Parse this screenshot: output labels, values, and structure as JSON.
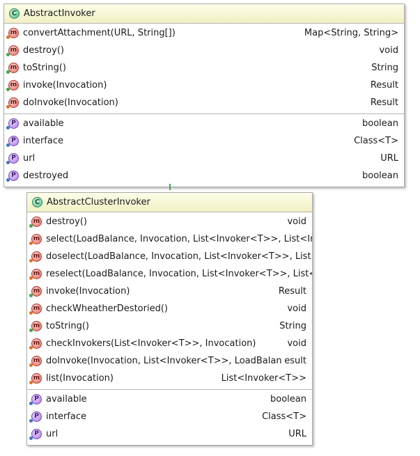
{
  "abstract_invoker": {
    "title": "AbstractInvoker",
    "kind_icon": "class-icon",
    "methods": [
      {
        "name": "convertAttachment(URL, String[])",
        "type": "Map<String, String>",
        "visibility": "protected",
        "icon": "method-icon"
      },
      {
        "name": "destroy()",
        "type": "void",
        "visibility": "public",
        "icon": "method-icon"
      },
      {
        "name": "toString()",
        "type": "String",
        "visibility": "public",
        "icon": "method-icon"
      },
      {
        "name": "invoke(Invocation)",
        "type": "Result",
        "visibility": "public",
        "icon": "method-icon"
      },
      {
        "name": "doInvoke(Invocation)",
        "type": "Result",
        "visibility": "protected-abstract",
        "icon": "method-icon"
      }
    ],
    "properties": [
      {
        "name": "available",
        "type": "boolean",
        "icon": "property-icon"
      },
      {
        "name": "interface",
        "type": "Class<T>",
        "icon": "property-icon"
      },
      {
        "name": "url",
        "type": "URL",
        "icon": "property-icon"
      },
      {
        "name": "destroyed",
        "type": "boolean",
        "icon": "property-icon"
      }
    ]
  },
  "abstract_cluster_invoker": {
    "title": "AbstractClusterInvoker",
    "kind_icon": "class-icon",
    "methods": [
      {
        "name": "destroy()",
        "type": "void",
        "visibility": "public",
        "icon": "method-icon"
      },
      {
        "name": "select(LoadBalance, Invocation, List<Invoker<T>>, List<Invoke",
        "type": "",
        "visibility": "protected",
        "icon": "method-icon"
      },
      {
        "name": "doselect(LoadBalance, Invocation, List<Invoker<T>>, List<Inv",
        "type": "",
        "visibility": "protected",
        "icon": "method-icon"
      },
      {
        "name": "reselect(LoadBalance, Invocation, List<Invoker<T>>, List<Invo",
        "type": "",
        "visibility": "protected",
        "icon": "method-icon"
      },
      {
        "name": "invoke(Invocation)",
        "type": "Result",
        "visibility": "public",
        "icon": "method-icon"
      },
      {
        "name": "checkWheatherDestoried()",
        "type": "void",
        "visibility": "protected",
        "icon": "method-icon"
      },
      {
        "name": "toString()",
        "type": "String",
        "visibility": "public",
        "icon": "method-icon"
      },
      {
        "name": "checkInvokers(List<Invoker<T>>, Invocation)",
        "type": "void",
        "visibility": "protected",
        "icon": "method-icon"
      },
      {
        "name": "doInvoke(Invocation, List<Invoker<T>>, LoadBalance)",
        "type": "esult",
        "visibility": "protected-abstract",
        "icon": "method-icon"
      },
      {
        "name": "list(Invocation)",
        "type": "List<Invoker<T>>",
        "visibility": "protected",
        "icon": "method-icon"
      }
    ],
    "properties": [
      {
        "name": "available",
        "type": "boolean",
        "icon": "property-icon"
      },
      {
        "name": "interface",
        "type": "Class<T>",
        "icon": "property-icon"
      },
      {
        "name": "url",
        "type": "URL",
        "icon": "property-icon"
      }
    ]
  },
  "icons": {
    "class": "C",
    "method": "m",
    "property": "P"
  },
  "colors": {
    "header_bg": "#f1f0c4",
    "border": "#a9a9a9",
    "method_icon": "#e16b61",
    "property_icon": "#a775e4",
    "class_icon": "#47b97e",
    "connector": "#3da648"
  }
}
